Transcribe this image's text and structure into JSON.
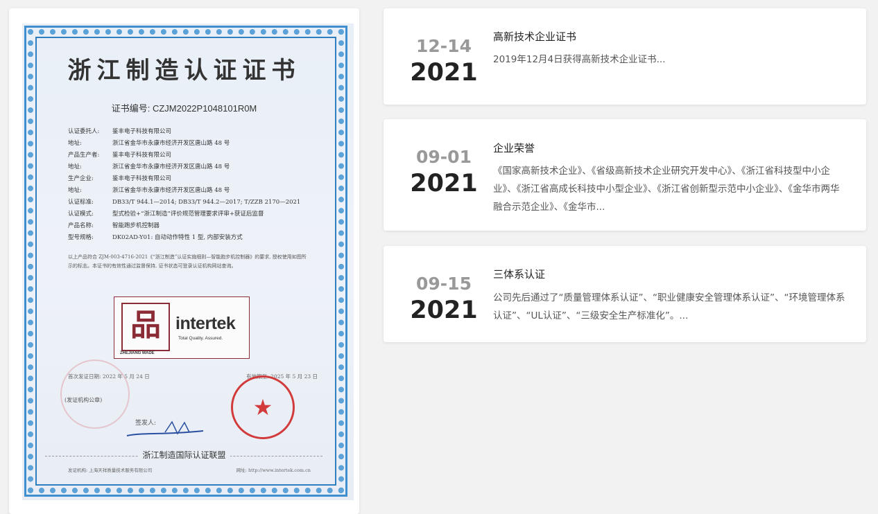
{
  "certificate": {
    "title": "浙江制造认证证书",
    "number": "证书编号: CZJM2022P1048101R0M",
    "fields": [
      {
        "k": "认证委托人:",
        "v": "鉴丰电子科技有限公司"
      },
      {
        "k": "地址:",
        "v": "浙江省金华市永康市经济开发区唐山路 48 号"
      },
      {
        "k": "产品生产者:",
        "v": "鉴丰电子科技有限公司"
      },
      {
        "k": "地址:",
        "v": "浙江省金华市永康市经济开发区唐山路 48 号"
      },
      {
        "k": "生产企业:",
        "v": "鉴丰电子科技有限公司"
      },
      {
        "k": "地址:",
        "v": "浙江省金华市永康市经济开发区唐山路 48 号"
      },
      {
        "k": "认证标准:",
        "v": "DB33/T 944.1—2014; DB33/T 944.2—2017; T/ZZB 2170—2021"
      },
      {
        "k": "认证模式:",
        "v": "型式检验+“浙江制造”评价规范管理要求评审+获证后监督"
      },
      {
        "k": "产品名称:",
        "v": "智能跑步机控制器"
      },
      {
        "k": "型号规格:",
        "v": "DK02AD-Y01: 自动动作特性 1 型, 内部安装方式"
      }
    ],
    "note": "以上产品符合 ZJM-003-4716-2021《“浙江制造”认证实施细则—智能跑步机控制器》的要求, 授权使用如图所示的标志。本证书的有效性通过监督保持, 证书状态可登录认证机构网站查询。",
    "logo_char": "品",
    "logo_sub": "ZHEJIANG MADE",
    "logo_brand": "intertek",
    "logo_tagline": "Total Quality. Assured.",
    "first_issue": "首次发证日期: 2022 年 5 月 24 日",
    "valid_until": "有效期至: 2025 年 5 月 23 日",
    "seal_label": "(发证机构公章)",
    "signer": "签发人:",
    "footer": "浙江制造国际认证联盟",
    "issuer": "发证机构: 上海天祥质量技术服务有限公司",
    "website": "网址: http://www.intertek.com.cn"
  },
  "news": [
    {
      "md": "12-14",
      "year": "2021",
      "title": "高新技术企业证书",
      "desc": "2019年12月4日获得高新技术企业证书..."
    },
    {
      "md": "09-01",
      "year": "2021",
      "title": "企业荣誉",
      "desc": "《国家高新技术企业》、《省级高新技术企业研究开发中心》、《浙江省科技型中小企业》、《浙江省高成长科技中小型企业》、《浙江省创新型示范中小企业》、《金华市两华融合示范企业》、《金华市..."
    },
    {
      "md": "09-15",
      "year": "2021",
      "title": "三体系认证",
      "desc": "公司先后通过了“质量管理体系认证”、“职业健康安全管理体系认证”、“环境管理体系认证”、“UL认证”、“三级安全生产标准化”。..."
    }
  ]
}
